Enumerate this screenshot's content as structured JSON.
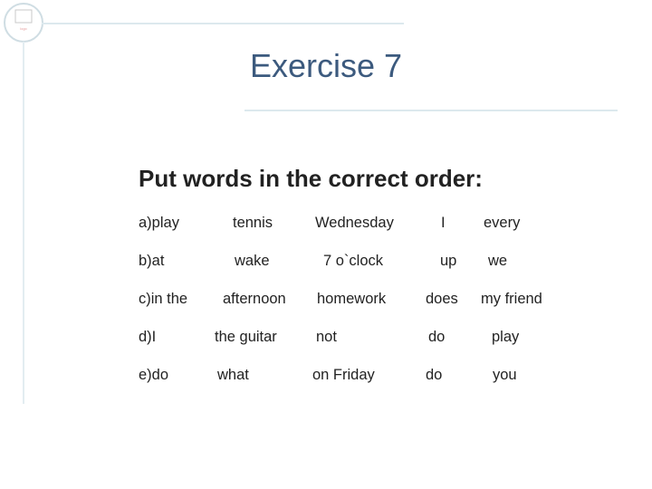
{
  "slide": {
    "title": "Exercise 7",
    "instruction": "Put words in the correct order:",
    "rows": [
      [
        "a)play",
        "tennis",
        "Wednesday",
        "I",
        "every"
      ],
      [
        "b)at",
        "wake",
        "7 o`clock",
        "up",
        "we"
      ],
      [
        "c)in the",
        "afternoon",
        "homework",
        "does",
        "my friend"
      ],
      [
        "d)I",
        "the guitar",
        "not",
        "do",
        "play"
      ],
      [
        "e)do",
        "what",
        "on Friday",
        "do",
        "you"
      ]
    ]
  },
  "colors": {
    "title": "#3c5a7e",
    "accent_line": "#dce9ee"
  }
}
